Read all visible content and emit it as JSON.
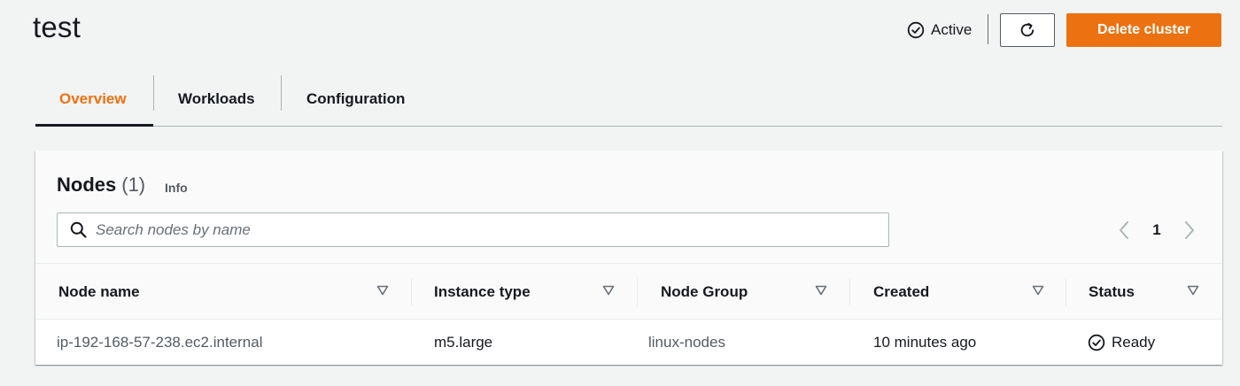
{
  "header": {
    "title": "test",
    "status": "Active",
    "refresh_icon": "refresh-icon",
    "delete_label": "Delete cluster"
  },
  "tabs": [
    {
      "label": "Overview",
      "active": true
    },
    {
      "label": "Workloads",
      "active": false
    },
    {
      "label": "Configuration",
      "active": false
    }
  ],
  "nodes_panel": {
    "title": "Nodes",
    "count": "(1)",
    "info_label": "Info",
    "search": {
      "placeholder": "Search nodes by name",
      "value": ""
    },
    "pagination": {
      "current_page": "1"
    },
    "columns": [
      "Node name",
      "Instance type",
      "Node Group",
      "Created",
      "Status"
    ],
    "rows": [
      {
        "node_name": "ip-192-168-57-238.ec2.internal",
        "instance_type": "m5.large",
        "node_group": "linux-nodes",
        "created": "10 minutes ago",
        "status": "Ready"
      }
    ]
  },
  "colors": {
    "accent": "#ec7211",
    "background": "#f2f3f3",
    "text": "#16191f",
    "muted": "#545b64"
  }
}
